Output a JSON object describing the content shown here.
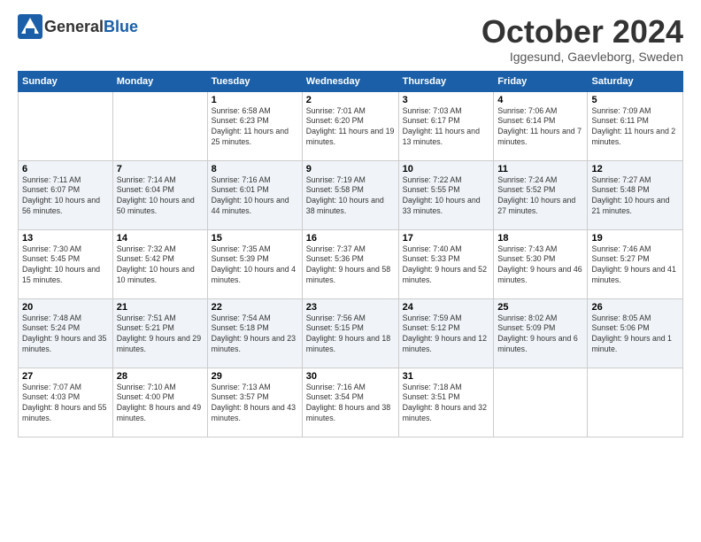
{
  "logo": {
    "general": "General",
    "blue": "Blue"
  },
  "header": {
    "month": "October 2024",
    "location": "Iggesund, Gaevleborg, Sweden"
  },
  "weekdays": [
    "Sunday",
    "Monday",
    "Tuesday",
    "Wednesday",
    "Thursday",
    "Friday",
    "Saturday"
  ],
  "weeks": [
    [
      {
        "day": "",
        "sunrise": "",
        "sunset": "",
        "daylight": ""
      },
      {
        "day": "",
        "sunrise": "",
        "sunset": "",
        "daylight": ""
      },
      {
        "day": "1",
        "sunrise": "Sunrise: 6:58 AM",
        "sunset": "Sunset: 6:23 PM",
        "daylight": "Daylight: 11 hours and 25 minutes."
      },
      {
        "day": "2",
        "sunrise": "Sunrise: 7:01 AM",
        "sunset": "Sunset: 6:20 PM",
        "daylight": "Daylight: 11 hours and 19 minutes."
      },
      {
        "day": "3",
        "sunrise": "Sunrise: 7:03 AM",
        "sunset": "Sunset: 6:17 PM",
        "daylight": "Daylight: 11 hours and 13 minutes."
      },
      {
        "day": "4",
        "sunrise": "Sunrise: 7:06 AM",
        "sunset": "Sunset: 6:14 PM",
        "daylight": "Daylight: 11 hours and 7 minutes."
      },
      {
        "day": "5",
        "sunrise": "Sunrise: 7:09 AM",
        "sunset": "Sunset: 6:11 PM",
        "daylight": "Daylight: 11 hours and 2 minutes."
      }
    ],
    [
      {
        "day": "6",
        "sunrise": "Sunrise: 7:11 AM",
        "sunset": "Sunset: 6:07 PM",
        "daylight": "Daylight: 10 hours and 56 minutes."
      },
      {
        "day": "7",
        "sunrise": "Sunrise: 7:14 AM",
        "sunset": "Sunset: 6:04 PM",
        "daylight": "Daylight: 10 hours and 50 minutes."
      },
      {
        "day": "8",
        "sunrise": "Sunrise: 7:16 AM",
        "sunset": "Sunset: 6:01 PM",
        "daylight": "Daylight: 10 hours and 44 minutes."
      },
      {
        "day": "9",
        "sunrise": "Sunrise: 7:19 AM",
        "sunset": "Sunset: 5:58 PM",
        "daylight": "Daylight: 10 hours and 38 minutes."
      },
      {
        "day": "10",
        "sunrise": "Sunrise: 7:22 AM",
        "sunset": "Sunset: 5:55 PM",
        "daylight": "Daylight: 10 hours and 33 minutes."
      },
      {
        "day": "11",
        "sunrise": "Sunrise: 7:24 AM",
        "sunset": "Sunset: 5:52 PM",
        "daylight": "Daylight: 10 hours and 27 minutes."
      },
      {
        "day": "12",
        "sunrise": "Sunrise: 7:27 AM",
        "sunset": "Sunset: 5:48 PM",
        "daylight": "Daylight: 10 hours and 21 minutes."
      }
    ],
    [
      {
        "day": "13",
        "sunrise": "Sunrise: 7:30 AM",
        "sunset": "Sunset: 5:45 PM",
        "daylight": "Daylight: 10 hours and 15 minutes."
      },
      {
        "day": "14",
        "sunrise": "Sunrise: 7:32 AM",
        "sunset": "Sunset: 5:42 PM",
        "daylight": "Daylight: 10 hours and 10 minutes."
      },
      {
        "day": "15",
        "sunrise": "Sunrise: 7:35 AM",
        "sunset": "Sunset: 5:39 PM",
        "daylight": "Daylight: 10 hours and 4 minutes."
      },
      {
        "day": "16",
        "sunrise": "Sunrise: 7:37 AM",
        "sunset": "Sunset: 5:36 PM",
        "daylight": "Daylight: 9 hours and 58 minutes."
      },
      {
        "day": "17",
        "sunrise": "Sunrise: 7:40 AM",
        "sunset": "Sunset: 5:33 PM",
        "daylight": "Daylight: 9 hours and 52 minutes."
      },
      {
        "day": "18",
        "sunrise": "Sunrise: 7:43 AM",
        "sunset": "Sunset: 5:30 PM",
        "daylight": "Daylight: 9 hours and 46 minutes."
      },
      {
        "day": "19",
        "sunrise": "Sunrise: 7:46 AM",
        "sunset": "Sunset: 5:27 PM",
        "daylight": "Daylight: 9 hours and 41 minutes."
      }
    ],
    [
      {
        "day": "20",
        "sunrise": "Sunrise: 7:48 AM",
        "sunset": "Sunset: 5:24 PM",
        "daylight": "Daylight: 9 hours and 35 minutes."
      },
      {
        "day": "21",
        "sunrise": "Sunrise: 7:51 AM",
        "sunset": "Sunset: 5:21 PM",
        "daylight": "Daylight: 9 hours and 29 minutes."
      },
      {
        "day": "22",
        "sunrise": "Sunrise: 7:54 AM",
        "sunset": "Sunset: 5:18 PM",
        "daylight": "Daylight: 9 hours and 23 minutes."
      },
      {
        "day": "23",
        "sunrise": "Sunrise: 7:56 AM",
        "sunset": "Sunset: 5:15 PM",
        "daylight": "Daylight: 9 hours and 18 minutes."
      },
      {
        "day": "24",
        "sunrise": "Sunrise: 7:59 AM",
        "sunset": "Sunset: 5:12 PM",
        "daylight": "Daylight: 9 hours and 12 minutes."
      },
      {
        "day": "25",
        "sunrise": "Sunrise: 8:02 AM",
        "sunset": "Sunset: 5:09 PM",
        "daylight": "Daylight: 9 hours and 6 minutes."
      },
      {
        "day": "26",
        "sunrise": "Sunrise: 8:05 AM",
        "sunset": "Sunset: 5:06 PM",
        "daylight": "Daylight: 9 hours and 1 minute."
      }
    ],
    [
      {
        "day": "27",
        "sunrise": "Sunrise: 7:07 AM",
        "sunset": "Sunset: 4:03 PM",
        "daylight": "Daylight: 8 hours and 55 minutes."
      },
      {
        "day": "28",
        "sunrise": "Sunrise: 7:10 AM",
        "sunset": "Sunset: 4:00 PM",
        "daylight": "Daylight: 8 hours and 49 minutes."
      },
      {
        "day": "29",
        "sunrise": "Sunrise: 7:13 AM",
        "sunset": "Sunset: 3:57 PM",
        "daylight": "Daylight: 8 hours and 43 minutes."
      },
      {
        "day": "30",
        "sunrise": "Sunrise: 7:16 AM",
        "sunset": "Sunset: 3:54 PM",
        "daylight": "Daylight: 8 hours and 38 minutes."
      },
      {
        "day": "31",
        "sunrise": "Sunrise: 7:18 AM",
        "sunset": "Sunset: 3:51 PM",
        "daylight": "Daylight: 8 hours and 32 minutes."
      },
      {
        "day": "",
        "sunrise": "",
        "sunset": "",
        "daylight": ""
      },
      {
        "day": "",
        "sunrise": "",
        "sunset": "",
        "daylight": ""
      }
    ]
  ]
}
